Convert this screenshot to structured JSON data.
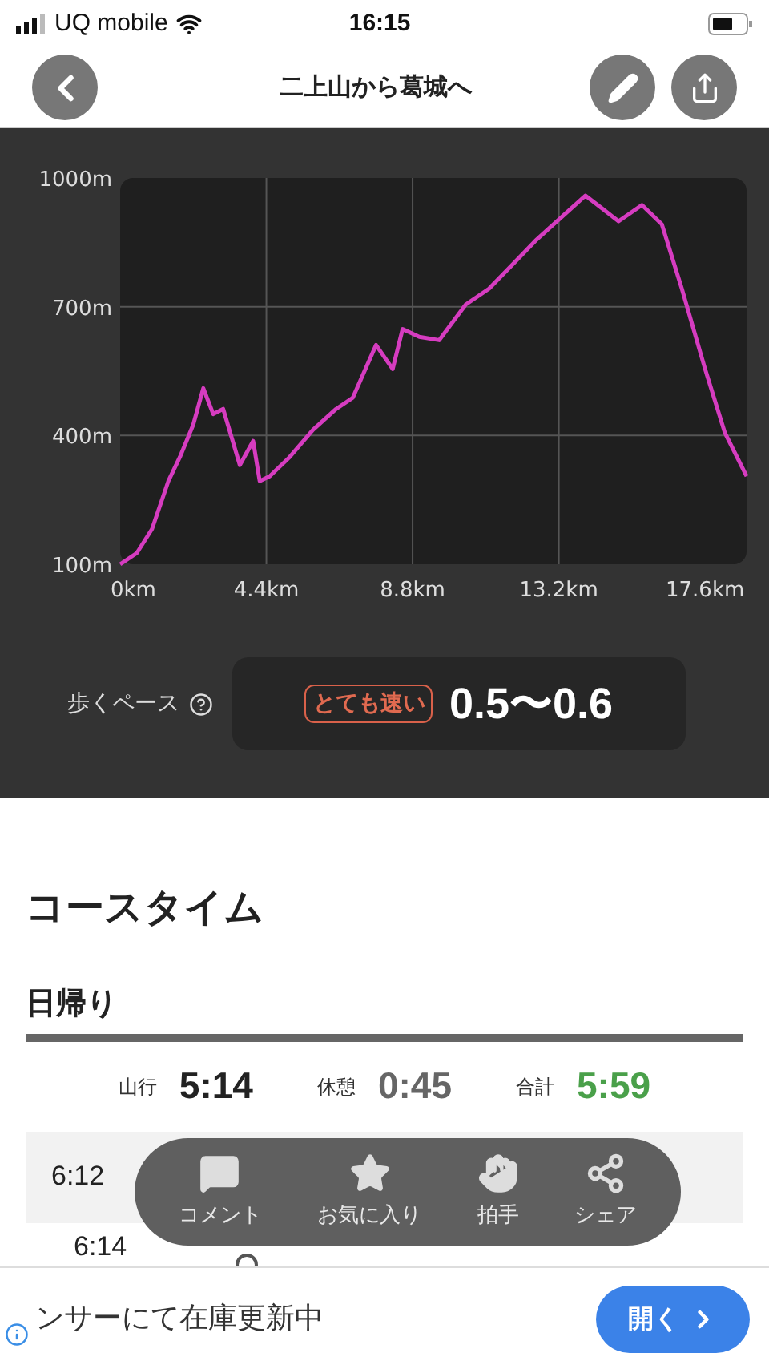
{
  "status_bar": {
    "carrier": "UQ mobile",
    "time": "16:15"
  },
  "header": {
    "title": "二上山から葛城へ"
  },
  "elevation": {
    "chart_data": {
      "type": "line",
      "x": [
        0,
        0.5,
        0.96,
        1.45,
        1.8,
        2.2,
        2.5,
        2.8,
        3.1,
        3.6,
        4.0,
        4.2,
        4.5,
        5.1,
        5.8,
        6.5,
        7.0,
        7.7,
        8.2,
        8.5,
        9.0,
        9.6,
        10.4,
        11.1,
        11.8,
        12.5,
        13.3,
        14.0,
        14.5,
        15.0,
        15.7,
        16.3,
        16.9,
        17.6,
        18.2,
        18.85
      ],
      "grid": true,
      "series": [
        {
          "color": "#d63cc0",
          "values": [
            100,
            126,
            182,
            294,
            350,
            425,
            510,
            450,
            462,
            331,
            387,
            294,
            305,
            350,
            413,
            462,
            488,
            611,
            555,
            648,
            630,
            622,
            705,
            742,
            798,
            854,
            910,
            959,
            929,
            899,
            937,
            892,
            742,
            555,
            406,
            305
          ]
        }
      ],
      "xlim": [
        0,
        18.85
      ],
      "ylim": [
        100,
        1000
      ],
      "xticks": [
        {
          "value": 0,
          "label": "0km"
        },
        {
          "value": 4.4,
          "label": "4.4km"
        },
        {
          "value": 8.8,
          "label": "8.8km"
        },
        {
          "value": 13.2,
          "label": "13.2km"
        },
        {
          "value": 17.6,
          "label": "17.6km"
        }
      ],
      "yticks": [
        {
          "value": 100,
          "label": "100m"
        },
        {
          "value": 400,
          "label": "400m"
        },
        {
          "value": 700,
          "label": "700m"
        },
        {
          "value": 1000,
          "label": "1000m"
        }
      ]
    }
  },
  "pace": {
    "label": "歩くペース",
    "badge": "とても速い",
    "value": "0.5〜0.6"
  },
  "course_time": {
    "title": "コースタイム",
    "tab": "日帰り",
    "stats": [
      {
        "label": "山行",
        "value": "5:14",
        "color": "#222222"
      },
      {
        "label": "休憩",
        "value": "0:45",
        "color": "#666666"
      },
      {
        "label": "合計",
        "value": "5:59",
        "color": "#4aa04a"
      }
    ],
    "timeline": [
      {
        "kind": "start",
        "time": "6:12"
      },
      {
        "kind": "point",
        "time": "6:14"
      }
    ]
  },
  "actions": [
    {
      "kind": "comment",
      "label": "コメント"
    },
    {
      "kind": "favorite",
      "label": "お気に入り"
    },
    {
      "kind": "clap",
      "label": "拍手"
    },
    {
      "kind": "share",
      "label": "シェア"
    }
  ],
  "ad": {
    "text": "ンサーにて在庫更新中",
    "button": "開く"
  }
}
